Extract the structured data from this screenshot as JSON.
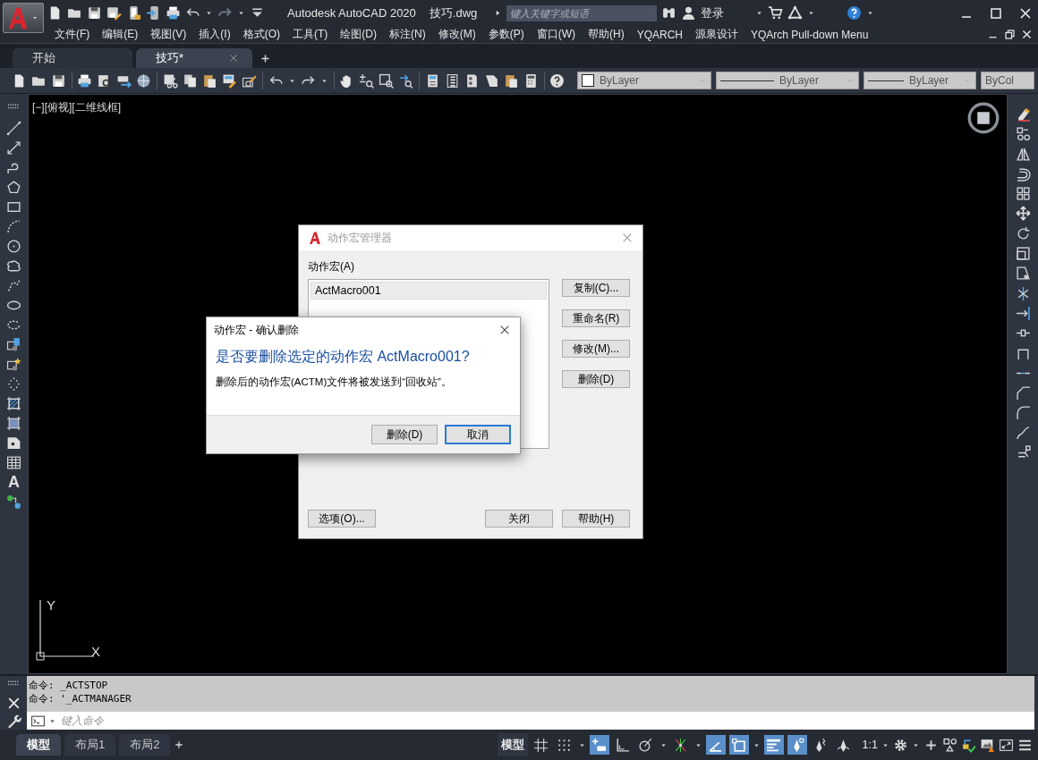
{
  "title_bar": {
    "app_title": "Autodesk AutoCAD 2020",
    "file_name": "技巧.dwg",
    "search": {
      "placeholder": "键入关键字或短语"
    },
    "sign_in": "登录"
  },
  "menu": [
    "文件(F)",
    "编辑(E)",
    "视图(V)",
    "插入(I)",
    "格式(O)",
    "工具(T)",
    "绘图(D)",
    "标注(N)",
    "修改(M)",
    "参数(P)",
    "窗口(W)",
    "帮助(H)",
    "YQARCH",
    "源泉设计",
    "YQArch Pull-down Menu"
  ],
  "doc_tabs": [
    {
      "label": "开始",
      "selected": false
    },
    {
      "label": "技巧*",
      "selected": true
    }
  ],
  "properties_toolbar": {
    "color_control": "ByLayer",
    "linetype": "ByLayer",
    "lineweight": "ByLayer",
    "plot_style": "ByCol"
  },
  "viewport_label": "[−][俯视][二维线框]",
  "text_tool_glyph": "A",
  "ucs": {
    "x": "X",
    "y": "Y"
  },
  "macro_manager": {
    "title": "动作宏管理器",
    "list_label": "动作宏(A)",
    "items": [
      {
        "label": "ActMacro001",
        "selected": true
      }
    ],
    "side_buttons": [
      "复制(C)...",
      "重命名(R)",
      "修改(M)...",
      "删除(D)"
    ],
    "options_button": "选项(O)...",
    "close_button": "关闭",
    "help_button": "帮助(H)"
  },
  "confirm_dialog": {
    "title": "动作宏 - 确认删除",
    "question": "是否要删除选定的动作宏 ActMacro001?",
    "note": "删除后的动作宏(ACTM)文件将被发送到“回收站”。",
    "buttons": [
      {
        "label": "删除(D)",
        "default": false
      },
      {
        "label": "取消",
        "default": true
      }
    ]
  },
  "command_line": {
    "history": [
      "命令: _ACTSTOP",
      "命令: '_ACTMANAGER"
    ],
    "placeholder": "键入命令"
  },
  "layout_tabs": [
    {
      "label": "模型",
      "selected": true
    },
    {
      "label": "布局1",
      "selected": false
    },
    {
      "label": "布局2",
      "selected": false
    }
  ],
  "status_bar": {
    "model_button": "模型",
    "scale": "1:1",
    "toggles": [
      {
        "kind": "grid",
        "on": false,
        "dropdown": false
      },
      {
        "kind": "snap",
        "on": false,
        "dropdown": true
      },
      {
        "kind": "dynamic-input",
        "on": true,
        "dropdown": false
      },
      {
        "kind": "ortho",
        "on": false,
        "dropdown": false
      },
      {
        "kind": "polar",
        "on": false,
        "dropdown": true
      },
      {
        "kind": "tracking",
        "on": false,
        "dropdown": true
      },
      {
        "kind": "isodraft",
        "on": true,
        "dropdown": false
      },
      {
        "kind": "osnap",
        "on": true,
        "dropdown": true
      },
      {
        "kind": "lineweight",
        "on": true,
        "dropdown": false
      },
      {
        "kind": "annotation-visibility",
        "on": true,
        "dropdown": false
      },
      {
        "kind": "autoscale",
        "on": false,
        "dropdown": false
      },
      {
        "kind": "annotation-scale",
        "on": false,
        "dropdown": false
      }
    ]
  }
}
